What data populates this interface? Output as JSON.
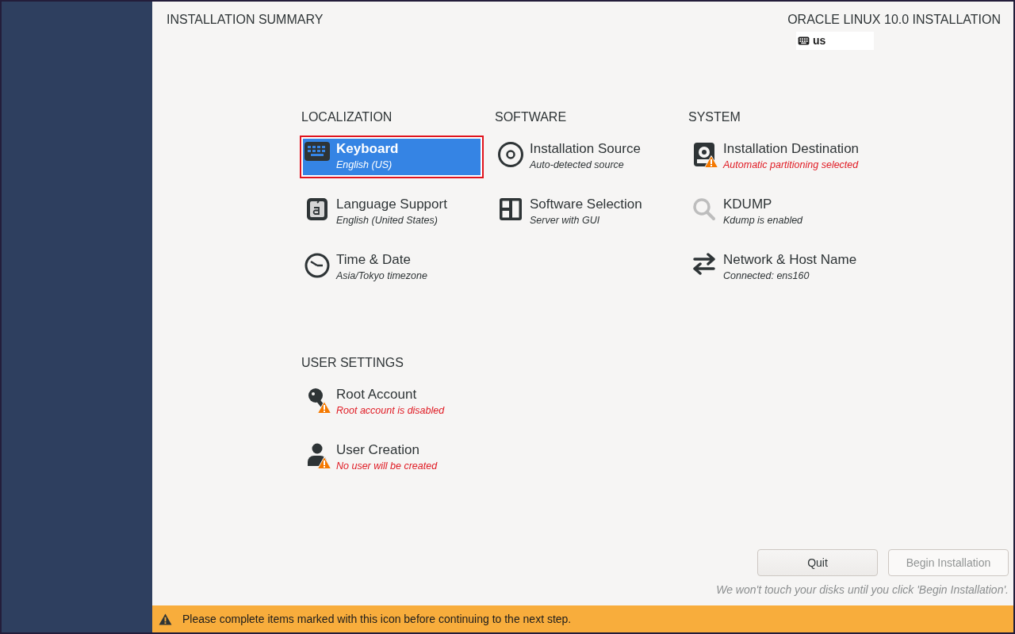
{
  "header": {
    "title": "INSTALLATION SUMMARY",
    "product": "ORACLE LINUX 10.0 INSTALLATION",
    "keyboard_layout": "us"
  },
  "sections": [
    {
      "title": "LOCALIZATION",
      "items": [
        {
          "kind": "keyboard",
          "title": "Keyboard",
          "status": "English (US)",
          "warning": false,
          "selected": true
        },
        {
          "kind": "language",
          "title": "Language Support",
          "status": "English (United States)",
          "warning": false,
          "selected": false
        },
        {
          "kind": "clock",
          "title": "Time & Date",
          "status": "Asia/Tokyo timezone",
          "warning": false,
          "selected": false
        }
      ]
    },
    {
      "title": "SOFTWARE",
      "items": [
        {
          "kind": "disc",
          "title": "Installation Source",
          "status": "Auto-detected source",
          "warning": false,
          "selected": false
        },
        {
          "kind": "package",
          "title": "Software Selection",
          "status": "Server with GUI",
          "warning": false,
          "selected": false
        }
      ]
    },
    {
      "title": "SYSTEM",
      "items": [
        {
          "kind": "disk",
          "title": "Installation Destination",
          "status": "Automatic partitioning selected",
          "warning": true,
          "selected": false
        },
        {
          "kind": "search",
          "title": "KDUMP",
          "status": "Kdump is enabled",
          "warning": false,
          "selected": false
        },
        {
          "kind": "arrows",
          "title": "Network & Host Name",
          "status": "Connected: ens160",
          "warning": false,
          "selected": false
        }
      ]
    },
    {
      "title": "USER SETTINGS",
      "items": [
        {
          "kind": "key",
          "title": "Root Account",
          "status": "Root account is disabled",
          "warning": true,
          "selected": false
        },
        {
          "kind": "user",
          "title": "User Creation",
          "status": "No user will be created",
          "warning": true,
          "selected": false
        }
      ]
    }
  ],
  "buttons": [
    {
      "label": "Quit",
      "disabled": false
    },
    {
      "label": "Begin Installation",
      "disabled": true
    }
  ],
  "note": "We won't touch your disks until you click 'Begin Installation'.",
  "warning_bar": "Please complete items marked with this icon before continuing to the next step."
}
